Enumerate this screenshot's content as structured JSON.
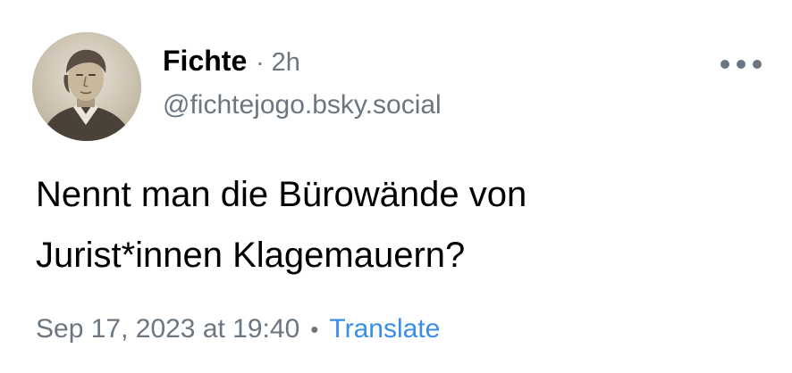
{
  "author": {
    "display_name": "Fichte",
    "separator": "·",
    "time_ago": "2h",
    "handle": "@fichtejogo.bsky.social"
  },
  "post": {
    "text_lines": [
      "Nennt man die Bürowände von",
      "Jurist*innen Klagemauern?"
    ]
  },
  "meta": {
    "timestamp": "Sep 17, 2023 at 19:40",
    "separator": "•",
    "translate_label": "Translate"
  },
  "icons": {
    "more": "more-options-icon"
  },
  "colors": {
    "text": "#000000",
    "muted": "#6b7680",
    "link": "#3b8ee8",
    "background": "#ffffff"
  }
}
